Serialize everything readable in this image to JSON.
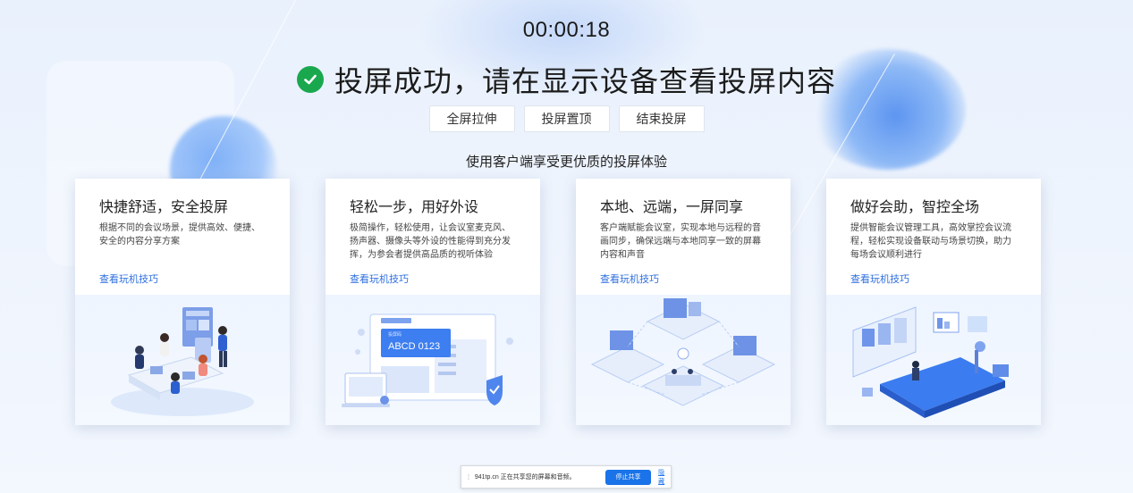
{
  "timer": "00:00:18",
  "headline": "投屏成功，请在显示设备查看投屏内容",
  "actions": [
    "全屏拉伸",
    "投屏置顶",
    "结束投屏"
  ],
  "subtitle": "使用客户端享受更优质的投屏体验",
  "cards": [
    {
      "title": "快捷舒适，安全投屏",
      "desc": "根据不同的会议场景，提供高效、便捷、安全的内容分享方案",
      "link": "查看玩机技巧"
    },
    {
      "title": "轻松一步，用好外设",
      "desc": "极简操作，轻松使用，让会议室麦克风、扬声器、摄像头等外设的性能得到充分发挥，为参会者提供高品质的视听体验",
      "link": "查看玩机技巧"
    },
    {
      "title": "本地、远端，一屏同享",
      "desc": "客户端赋能会议室，实现本地与远程的音画同步，确保远端与本地同享一致的屏幕内容和声音",
      "link": "查看玩机技巧"
    },
    {
      "title": "做好会助，智控全场",
      "desc": "提供智能会议管理工具，高效掌控会议流程，轻松实现设备联动与场景切换，助力每场会议顺利进行",
      "link": "查看玩机技巧"
    }
  ],
  "illustration_text": {
    "card2_label": "ABCD 0123",
    "card2_sublabel": "投屏码"
  },
  "share_bar": {
    "message": "941tp.cn 正在共享您的屏幕和音频。",
    "stop_label": "停止共享",
    "hide_label": "隐藏"
  },
  "colors": {
    "accent": "#2f6fde",
    "success": "#1aa84f",
    "stop_button": "#1a73e8"
  }
}
